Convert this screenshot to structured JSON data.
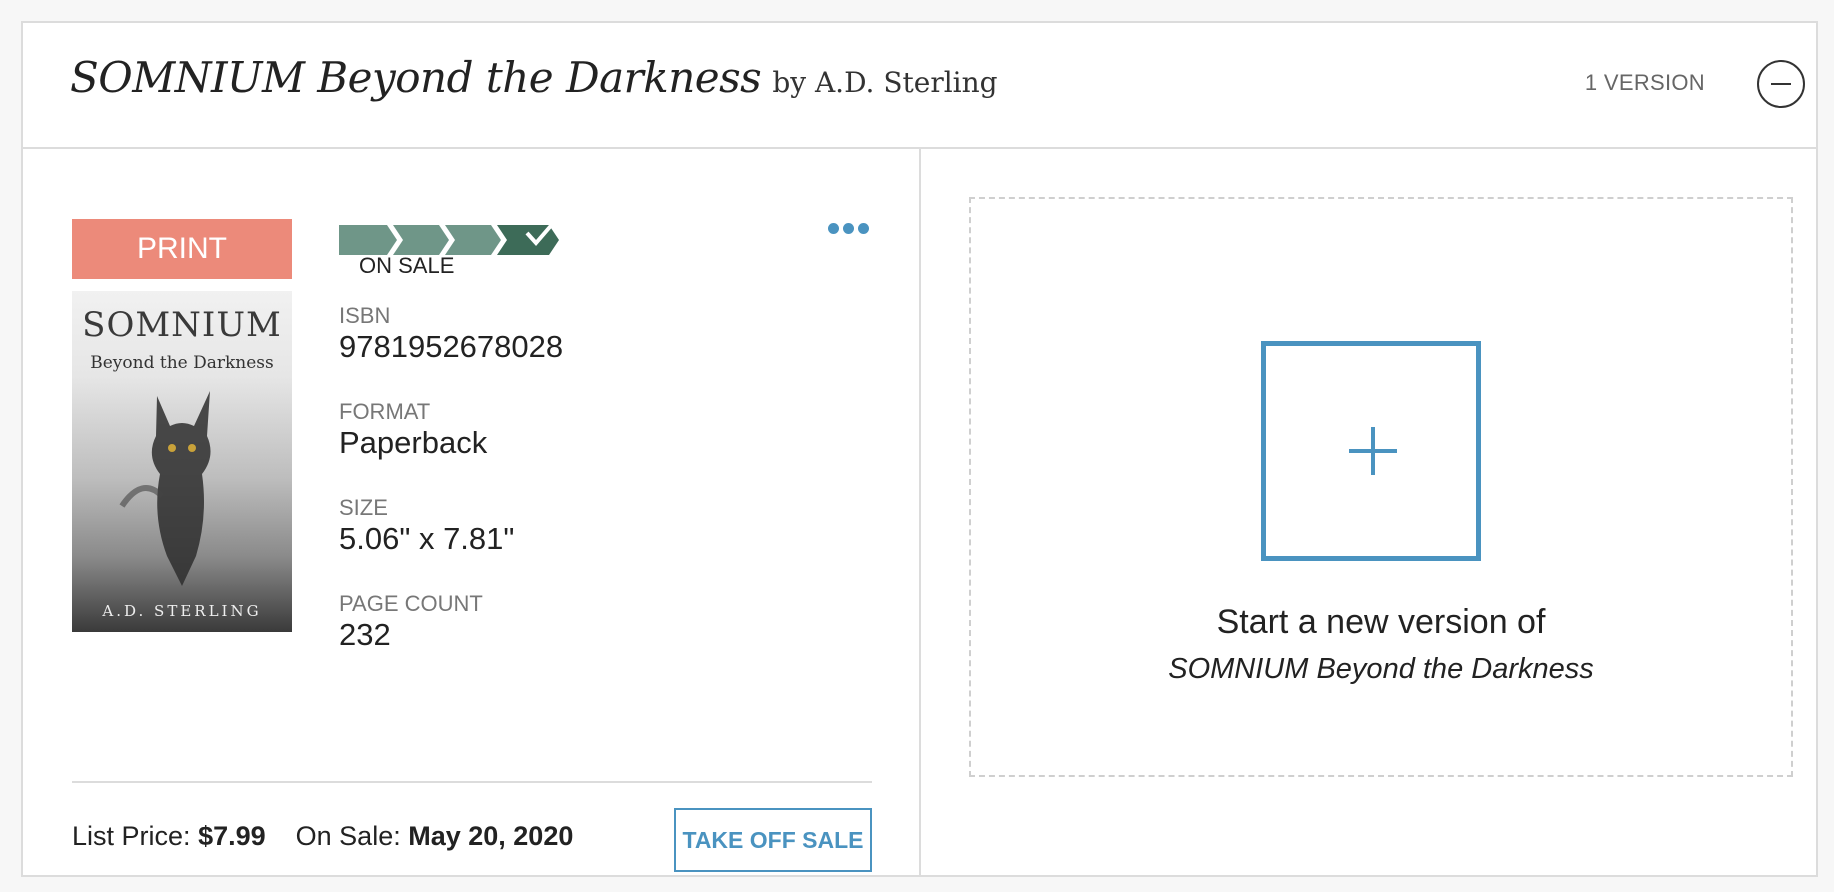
{
  "header": {
    "title": "SOMNIUM Beyond the Darkness",
    "byline": "by A.D. Sterling",
    "version_count": "1 VERSION"
  },
  "version": {
    "format_tag": "PRINT",
    "cover": {
      "title": "SOMNIUM",
      "subtitle": "Beyond the Darkness",
      "author": "A.D. STERLING"
    },
    "status": {
      "label": "ON SALE",
      "steps_total": 4,
      "steps_completed": 4,
      "color_done": "#6f9688",
      "color_current": "#3d6b58"
    },
    "fields": [
      {
        "label": "ISBN",
        "value": "9781952678028"
      },
      {
        "label": "FORMAT",
        "value": "Paperback"
      },
      {
        "label": "SIZE",
        "value": "5.06\" x 7.81\""
      },
      {
        "label": "PAGE COUNT",
        "value": "232"
      }
    ],
    "list_price_label": "List Price:",
    "list_price": "$7.99",
    "on_sale_label": "On Sale:",
    "on_sale_date": "May 20, 2020",
    "take_off_sale_label": "TAKE OFF SALE"
  },
  "new_version": {
    "line1": "Start a new version of",
    "line2": "SOMNIUM Beyond the Darkness"
  },
  "colors": {
    "accent": "#4a93c0",
    "print_tag": "#ec8a7a"
  }
}
